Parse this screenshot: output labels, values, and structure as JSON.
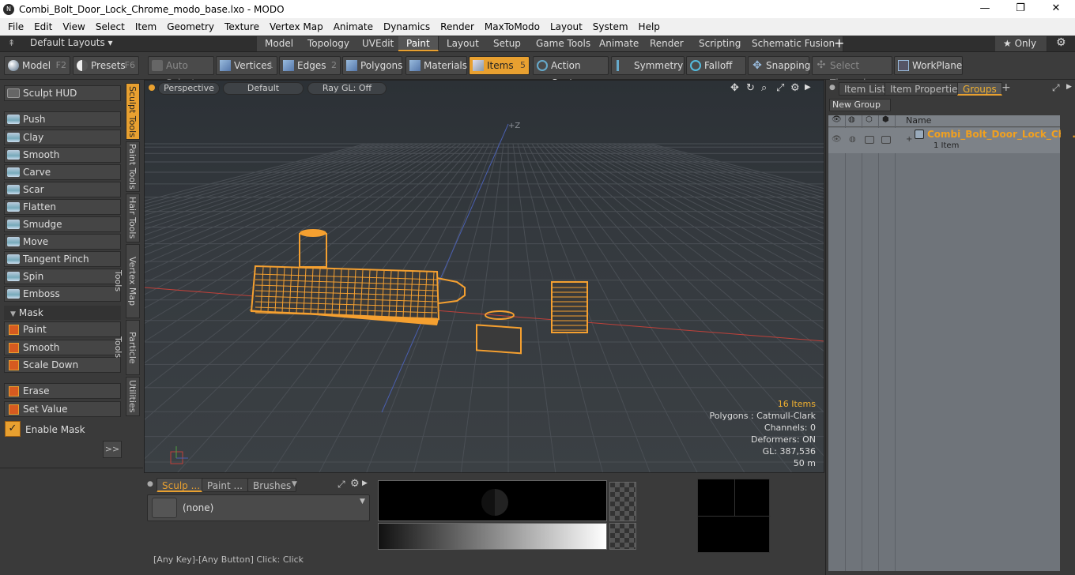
{
  "window": {
    "title": "Combi_Bolt_Door_Lock_Chrome_modo_base.lxo - MODO",
    "minimize": "—",
    "maximize": "❐",
    "close": "✕"
  },
  "menu": [
    "File",
    "Edit",
    "View",
    "Select",
    "Item",
    "Geometry",
    "Texture",
    "Vertex Map",
    "Animate",
    "Dynamics",
    "Render",
    "MaxToModo",
    "Layout",
    "System",
    "Help"
  ],
  "layouts": {
    "selector": "Default Layouts ▾",
    "tabs": [
      "Model",
      "Topology",
      "UVEdit",
      "Paint",
      "Layout",
      "Setup",
      "Game Tools",
      "Animate",
      "Render",
      "Scripting",
      "Schematic Fusion"
    ],
    "active": "Paint",
    "add": "+",
    "only": "★  Only",
    "settings": "⚙"
  },
  "toolbar": {
    "model": "Model",
    "model_key": "F2",
    "presets": "Presets",
    "presets_key": "F6",
    "auto_select": "Auto Select",
    "vertices": "Vertices",
    "vertices_key": "1",
    "edges": "Edges",
    "edges_key": "2",
    "polygons": "Polygons",
    "materials": "Materials",
    "items": "Items",
    "items_key": "5",
    "action_center": "Action Center",
    "symmetry": "Symmetry",
    "falloff": "Falloff",
    "snapping": "Snapping",
    "select_through": "Select Through",
    "workplane": "WorkPlane"
  },
  "sculpt": {
    "hud": "Sculpt HUD",
    "tools": [
      "Push",
      "Clay",
      "Smooth",
      "Carve",
      "Scar",
      "Flatten",
      "Smudge",
      "Move",
      "Tangent Pinch",
      "Spin",
      "Emboss"
    ],
    "mask_header": "Mask",
    "mask_tools": [
      "Paint",
      "Smooth",
      "Scale Down"
    ],
    "erase": "Erase",
    "set_value": "Set Value",
    "enable_mask": "Enable Mask",
    "expand": ">>"
  },
  "vtabs": [
    "Sculpt Tools",
    "Paint Tools",
    "Hair Tools",
    "Vertex Map Tools",
    "Particle Tools",
    "Utilities"
  ],
  "viewport": {
    "view": "Perspective",
    "shading": "Default",
    "raygl": "Ray GL: Off",
    "axis_label": "+Z",
    "hud": {
      "items": "16 Items",
      "polygons": "Polygons : Catmull-Clark",
      "channels": "Channels: 0",
      "deformers": "Deformers: ON",
      "gl": "GL: 387,536",
      "scale": "50 m"
    }
  },
  "bottom": {
    "tabs": [
      "Sculp ...",
      "Paint ...",
      "Brushes"
    ],
    "brush_value": "(none)"
  },
  "status": "[Any Key]-[Any Button] Click:  Click",
  "right": {
    "tabs": [
      "Item List",
      "Item Properties",
      "Groups"
    ],
    "active": "Groups",
    "new_group": "New Group",
    "col_name": "Name",
    "group_name": "Combi_Bolt_Door_Lock_Ch...",
    "group_count": "1 Item"
  },
  "colors": {
    "accent": "#e8a030",
    "wire": "#f5a030",
    "x_axis": "#c0413a",
    "y_axis": "#4a5fb0"
  }
}
